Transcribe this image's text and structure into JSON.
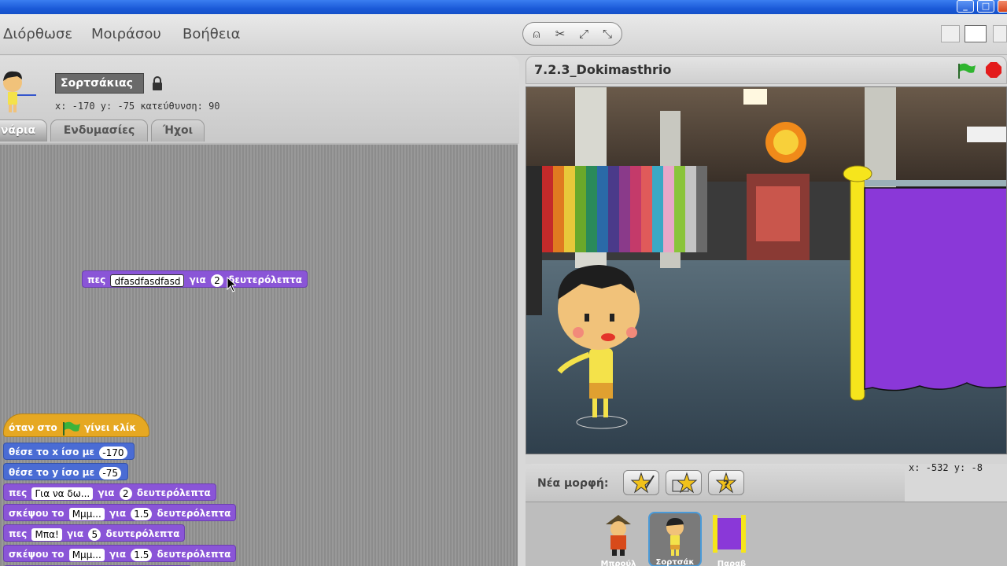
{
  "menu": {
    "items": [
      "Διόρθωσε",
      "Μοιράσου",
      "Βοήθεια"
    ]
  },
  "sprite": {
    "name": "Σορτσάκιας",
    "coords": "x: -170  y: -75   κατεύθυνση: 90"
  },
  "tabs": [
    "νάρια",
    "Ενδυμασίες",
    "Ήχοι"
  ],
  "blocks": {
    "floating": {
      "say": "πες",
      "text": "dfasdfasdfasd",
      "for": "για",
      "num": "2",
      "secs": "δευτερόλεπτα"
    },
    "hat": {
      "pre": "όταν στο",
      "post": "γίνει κλίκ"
    },
    "setx": {
      "label": "θέσε το x ίσο με",
      "val": "-170"
    },
    "sety": {
      "label": "θέσε το y ίσο με",
      "val": "-75"
    },
    "say1": {
      "say": "πες",
      "text": "Για να δω...",
      "for": "για",
      "num": "2",
      "secs": "δευτερόλεπτα"
    },
    "think1": {
      "label": "σκέψου το",
      "text": "Μμμ...",
      "for": "για",
      "num": "1.5",
      "secs": "δευτερόλεπτα"
    },
    "say2": {
      "say": "πες",
      "text": "Μπα!",
      "for": "για",
      "num": "5",
      "secs": "δευτερόλεπτα"
    },
    "think2": {
      "label": "σκέψου το",
      "text": "Μμμ...",
      "for": "για",
      "num": "1.5",
      "secs": "δευτερόλεπτα"
    }
  },
  "stage": {
    "title": "7.2.3_Dokimasthrio",
    "mouse_coords": "x: -532   y: -8"
  },
  "newsprite": {
    "label": "Νέα μορφή:"
  },
  "sprites": [
    {
      "name": "Μπρούλ"
    },
    {
      "name": "Σορτσάκ"
    },
    {
      "name": "Παραβ"
    }
  ],
  "colors": {
    "looks": "#8a55d7",
    "motion": "#4a6cd4",
    "control": "#e6a822"
  }
}
